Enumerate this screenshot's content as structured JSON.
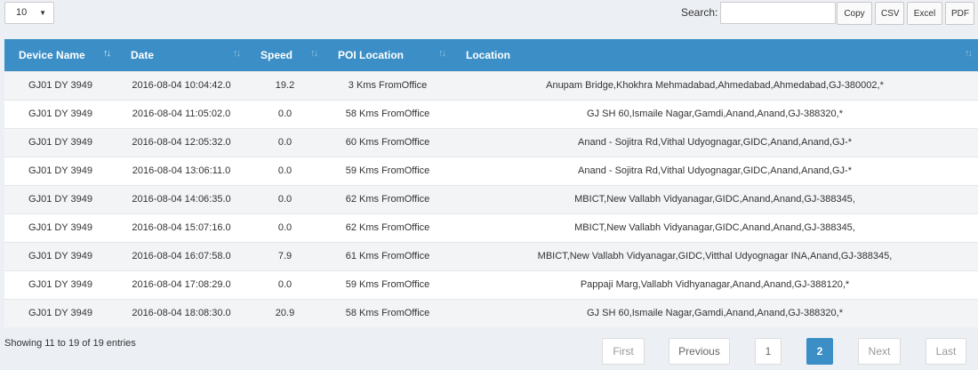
{
  "controls": {
    "page_length": "10",
    "search_label": "Search:",
    "search_value": "",
    "buttons": {
      "copy": "Copy",
      "csv": "CSV",
      "excel": "Excel",
      "pdf": "PDF"
    }
  },
  "table": {
    "header_color": "#3b8fc6",
    "columns": [
      "Device Name",
      "Date",
      "Speed",
      "POI Location",
      "Location"
    ],
    "rows": [
      [
        "GJ01 DY 3949",
        "2016-08-04 10:04:42.0",
        "19.2",
        "3 Kms FromOffice",
        "Anupam Bridge,Khokhra Mehmadabad,Ahmedabad,Ahmedabad,GJ-380002,*"
      ],
      [
        "GJ01 DY 3949",
        "2016-08-04 11:05:02.0",
        "0.0",
        "58 Kms FromOffice",
        "GJ SH 60,Ismaile Nagar,Gamdi,Anand,Anand,GJ-388320,*"
      ],
      [
        "GJ01 DY 3949",
        "2016-08-04 12:05:32.0",
        "0.0",
        "60 Kms FromOffice",
        "Anand - Sojitra Rd,Vithal Udyognagar,GIDC,Anand,Anand,GJ-*"
      ],
      [
        "GJ01 DY 3949",
        "2016-08-04 13:06:11.0",
        "0.0",
        "59 Kms FromOffice",
        "Anand - Sojitra Rd,Vithal Udyognagar,GIDC,Anand,Anand,GJ-*"
      ],
      [
        "GJ01 DY 3949",
        "2016-08-04 14:06:35.0",
        "0.0",
        "62 Kms FromOffice",
        "MBICT,New Vallabh Vidyanagar,GIDC,Anand,Anand,GJ-388345,"
      ],
      [
        "GJ01 DY 3949",
        "2016-08-04 15:07:16.0",
        "0.0",
        "62 Kms FromOffice",
        "MBICT,New Vallabh Vidyanagar,GIDC,Anand,Anand,GJ-388345,"
      ],
      [
        "GJ01 DY 3949",
        "2016-08-04 16:07:58.0",
        "7.9",
        "61 Kms FromOffice",
        "MBICT,New Vallabh Vidyanagar,GIDC,Vitthal Udyognagar INA,Anand,GJ-388345,"
      ],
      [
        "GJ01 DY 3949",
        "2016-08-04 17:08:29.0",
        "0.0",
        "59 Kms FromOffice",
        "Pappaji Marg,Vallabh Vidhyanagar,Anand,Anand,GJ-388120,*"
      ],
      [
        "GJ01 DY 3949",
        "2016-08-04 18:08:30.0",
        "20.9",
        "58 Kms FromOffice",
        "GJ SH 60,Ismaile Nagar,Gamdi,Anand,Anand,GJ-388320,*"
      ]
    ]
  },
  "footer": {
    "info": "Showing 11 to 19 of 19 entries",
    "pagination": {
      "first": "First",
      "previous": "Previous",
      "page1": "1",
      "page2": "2",
      "next": "Next",
      "last": "Last"
    }
  }
}
